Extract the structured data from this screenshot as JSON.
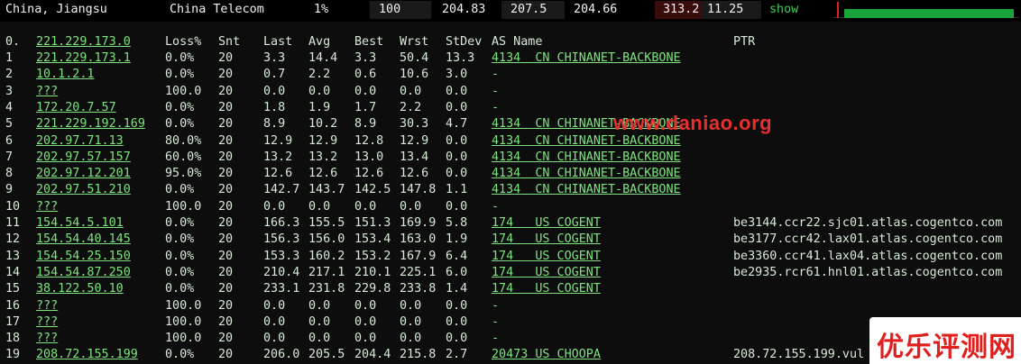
{
  "topbar": {
    "location": "China, Jiangsu",
    "isp": "China Telecom",
    "loss": "1%",
    "sent": "100",
    "last": "204.83",
    "avg": "207.5",
    "best": "204.66",
    "worst": "313.2",
    "stdev": "11.25",
    "show_label": "show"
  },
  "header": {
    "hop": "0.",
    "host": "221.229.173.0",
    "loss": "Loss%",
    "snt": "Snt",
    "last": "Last",
    "avg": "Avg",
    "best": "Best",
    "wrst": "Wrst",
    "stdev": "StDev",
    "as": "AS Name",
    "ptr": "PTR"
  },
  "rows": [
    {
      "hop": "1",
      "host": "221.229.173.1",
      "loss": "0.0%",
      "snt": "20",
      "last": "3.3",
      "avg": "14.4",
      "best": "3.3",
      "wrst": "50.4",
      "stdev": "13.3",
      "as": "4134  CN CHINANET-BACKBONE",
      "ptr": ""
    },
    {
      "hop": "2",
      "host": "10.1.2.1",
      "loss": "0.0%",
      "snt": "20",
      "last": "0.7",
      "avg": "2.2",
      "best": "0.6",
      "wrst": "10.6",
      "stdev": "3.0",
      "as": "-",
      "ptr": ""
    },
    {
      "hop": "3",
      "host": "???",
      "loss": "100.0",
      "snt": "20",
      "last": "0.0",
      "avg": "0.0",
      "best": "0.0",
      "wrst": "0.0",
      "stdev": "0.0",
      "as": "-",
      "ptr": ""
    },
    {
      "hop": "4",
      "host": "172.20.7.57",
      "loss": "0.0%",
      "snt": "20",
      "last": "1.8",
      "avg": "1.9",
      "best": "1.7",
      "wrst": "2.2",
      "stdev": "0.0",
      "as": "-",
      "ptr": ""
    },
    {
      "hop": "5",
      "host": "221.229.192.169",
      "loss": "0.0%",
      "snt": "20",
      "last": "8.9",
      "avg": "10.2",
      "best": "8.9",
      "wrst": "30.3",
      "stdev": "4.7",
      "as": "4134  CN CHINANET-BACKBONE",
      "ptr": ""
    },
    {
      "hop": "6",
      "host": "202.97.71.13",
      "loss": "80.0%",
      "snt": "20",
      "last": "12.9",
      "avg": "12.9",
      "best": "12.8",
      "wrst": "12.9",
      "stdev": "0.0",
      "as": "4134  CN CHINANET-BACKBONE",
      "ptr": ""
    },
    {
      "hop": "7",
      "host": "202.97.57.157",
      "loss": "60.0%",
      "snt": "20",
      "last": "13.2",
      "avg": "13.2",
      "best": "13.0",
      "wrst": "13.4",
      "stdev": "0.0",
      "as": "4134  CN CHINANET-BACKBONE",
      "ptr": ""
    },
    {
      "hop": "8",
      "host": "202.97.12.201",
      "loss": "95.0%",
      "snt": "20",
      "last": "12.6",
      "avg": "12.6",
      "best": "12.6",
      "wrst": "12.6",
      "stdev": "0.0",
      "as": "4134  CN CHINANET-BACKBONE",
      "ptr": ""
    },
    {
      "hop": "9",
      "host": "202.97.51.210",
      "loss": "0.0%",
      "snt": "20",
      "last": "142.7",
      "avg": "143.7",
      "best": "142.5",
      "wrst": "147.8",
      "stdev": "1.1",
      "as": "4134  CN CHINANET-BACKBONE",
      "ptr": ""
    },
    {
      "hop": "10",
      "host": "???",
      "loss": "100.0",
      "snt": "20",
      "last": "0.0",
      "avg": "0.0",
      "best": "0.0",
      "wrst": "0.0",
      "stdev": "0.0",
      "as": "-",
      "ptr": ""
    },
    {
      "hop": "11",
      "host": "154.54.5.101",
      "loss": "0.0%",
      "snt": "20",
      "last": "166.3",
      "avg": "155.5",
      "best": "151.3",
      "wrst": "169.9",
      "stdev": "5.8",
      "as": "174   US COGENT",
      "ptr": "be3144.ccr22.sjc01.atlas.cogentco.com"
    },
    {
      "hop": "12",
      "host": "154.54.40.145",
      "loss": "0.0%",
      "snt": "20",
      "last": "156.3",
      "avg": "156.0",
      "best": "153.4",
      "wrst": "163.0",
      "stdev": "1.9",
      "as": "174   US COGENT",
      "ptr": "be3177.ccr42.lax01.atlas.cogentco.com"
    },
    {
      "hop": "13",
      "host": "154.54.25.150",
      "loss": "0.0%",
      "snt": "20",
      "last": "153.3",
      "avg": "160.2",
      "best": "153.2",
      "wrst": "167.9",
      "stdev": "6.4",
      "as": "174   US COGENT",
      "ptr": "be3360.ccr41.lax04.atlas.cogentco.com"
    },
    {
      "hop": "14",
      "host": "154.54.87.250",
      "loss": "0.0%",
      "snt": "20",
      "last": "210.4",
      "avg": "217.1",
      "best": "210.1",
      "wrst": "225.1",
      "stdev": "6.0",
      "as": "174   US COGENT",
      "ptr": "be2935.rcr61.hnl01.atlas.cogentco.com"
    },
    {
      "hop": "15",
      "host": "38.122.50.10",
      "loss": "0.0%",
      "snt": "20",
      "last": "233.1",
      "avg": "231.8",
      "best": "229.8",
      "wrst": "233.8",
      "stdev": "1.4",
      "as": "174   US COGENT",
      "ptr": ""
    },
    {
      "hop": "16",
      "host": "???",
      "loss": "100.0",
      "snt": "20",
      "last": "0.0",
      "avg": "0.0",
      "best": "0.0",
      "wrst": "0.0",
      "stdev": "0.0",
      "as": "-",
      "ptr": ""
    },
    {
      "hop": "17",
      "host": "???",
      "loss": "100.0",
      "snt": "20",
      "last": "0.0",
      "avg": "0.0",
      "best": "0.0",
      "wrst": "0.0",
      "stdev": "0.0",
      "as": "-",
      "ptr": ""
    },
    {
      "hop": "18",
      "host": "???",
      "loss": "100.0",
      "snt": "20",
      "last": "0.0",
      "avg": "0.0",
      "best": "0.0",
      "wrst": "0.0",
      "stdev": "0.0",
      "as": "-",
      "ptr": ""
    },
    {
      "hop": "19",
      "host": "208.72.155.199",
      "loss": "0.0%",
      "snt": "20",
      "last": "206.0",
      "avg": "205.5",
      "best": "204.4",
      "wrst": "215.8",
      "stdev": "2.7",
      "as": "20473 US CHOOPA",
      "ptr": "208.72.155.199.vul"
    }
  ],
  "watermarks": {
    "url": "www.daniao.org",
    "logo": "优乐评测网"
  },
  "colors": {
    "accent_green": "#7ee37e",
    "show_green": "#39d353",
    "watermark_red": "#e53030",
    "max_cell_bg": "#3a0b0b"
  }
}
